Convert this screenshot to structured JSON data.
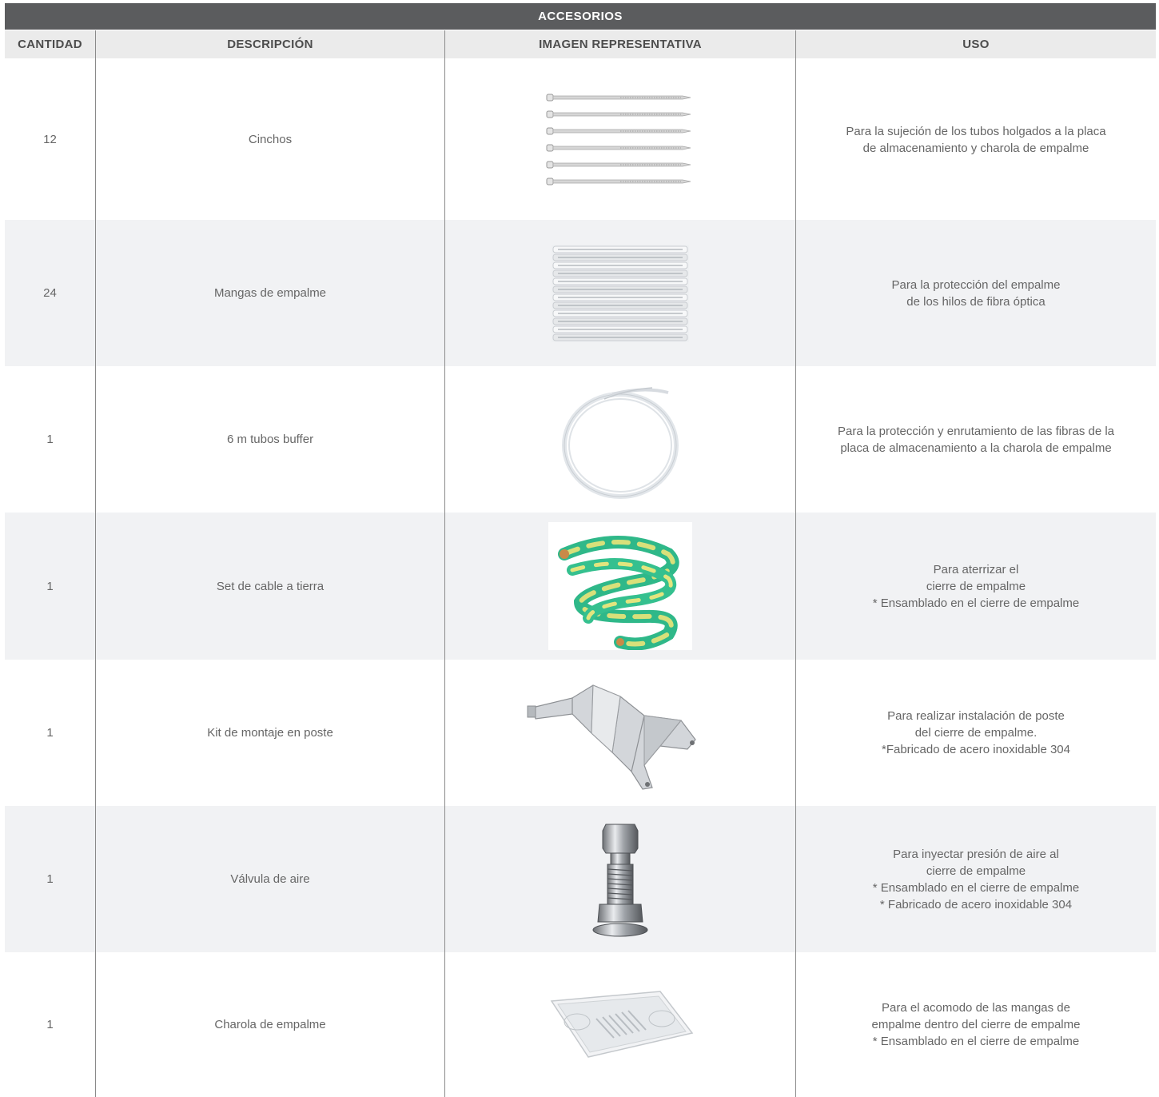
{
  "table": {
    "title": "ACCESORIOS",
    "headers": {
      "cantidad": "CANTIDAD",
      "descripcion": "DESCRIPCIÓN",
      "imagen": "IMAGEN REPRESENTATIVA",
      "uso": "USO"
    },
    "rows": [
      {
        "cantidad": "12",
        "descripcion": "Cinchos",
        "image_icon": "cable-ties-icon",
        "uso": [
          "Para la sujeción de los tubos holgados a la placa",
          "de almacenamiento y charola de empalme"
        ]
      },
      {
        "cantidad": "24",
        "descripcion": "Mangas de empalme",
        "image_icon": "splice-sleeves-icon",
        "uso": [
          "Para la protección del empalme",
          "de los hilos de fibra óptica"
        ]
      },
      {
        "cantidad": "1",
        "descripcion": "6 m tubos buffer",
        "image_icon": "buffer-tube-coil-icon",
        "uso": [
          "Para la protección y enrutamiento de las fibras de la",
          "placa de almacenamiento a la charola de empalme"
        ]
      },
      {
        "cantidad": "1",
        "descripcion": "Set de cable a tierra",
        "image_icon": "ground-cable-coil-icon",
        "uso": [
          "Para aterrizar el",
          "cierre de empalme",
          "* Ensamblado en el cierre de empalme"
        ]
      },
      {
        "cantidad": "1",
        "descripcion": "Kit de montaje en poste",
        "image_icon": "pole-mount-bracket-icon",
        "uso": [
          "Para realizar instalación de poste",
          "del cierre de empalme.",
          "*Fabricado de acero inoxidable 304"
        ]
      },
      {
        "cantidad": "1",
        "descripcion": "Válvula de aire",
        "image_icon": "air-valve-icon",
        "uso": [
          "Para inyectar presión de aire al",
          "cierre de empalme",
          "* Ensamblado en el cierre de empalme",
          "* Fabricado de acero inoxidable 304"
        ]
      },
      {
        "cantidad": "1",
        "descripcion": "Charola de empalme",
        "image_icon": "splice-tray-icon",
        "uso": [
          "Para el acomodo de las mangas de",
          "empalme dentro del cierre de empalme",
          "* Ensamblado en el cierre de empalme"
        ]
      }
    ]
  },
  "colors": {
    "title_bg": "#5b5c5e",
    "header_bg": "#ebebeb",
    "row_alt_bg": "#f1f2f4",
    "text": "#666666",
    "ground_cable_green": "#3fbf8a",
    "ground_cable_yellow": "#d8e07a"
  }
}
